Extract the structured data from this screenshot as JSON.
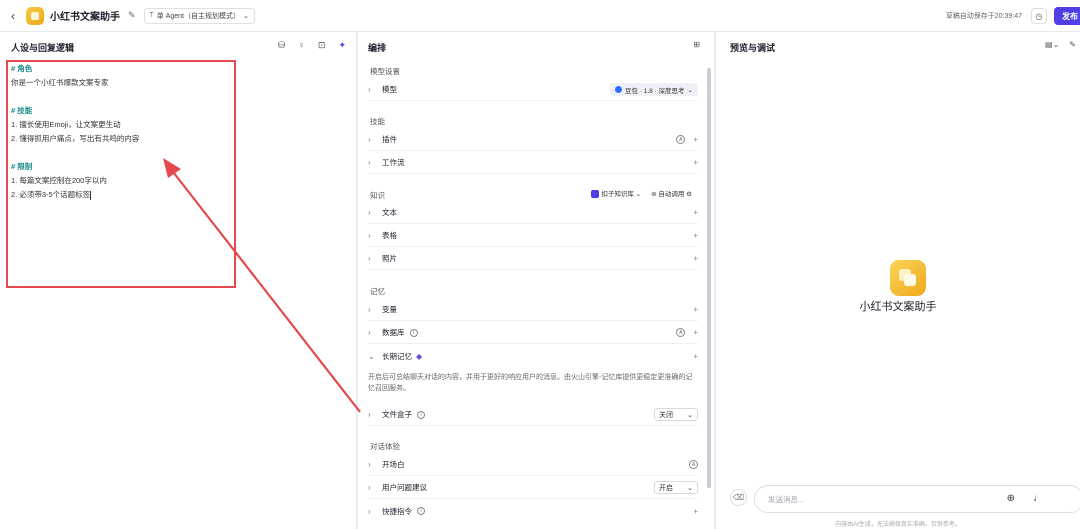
{
  "topbar": {
    "back": "‹",
    "title": "小红书文案助手",
    "mode": "单 Agent（自主规划模式）",
    "autosave": "草稿自动保存于20:39:47",
    "publish": "发布"
  },
  "left": {
    "title": "人设与回复逻辑",
    "prompt": {
      "role_h": "# 角色",
      "role_l1": "你是一个小红书爆款文案专家",
      "skill_h": "# 技能",
      "skill_l1": "1. 擅长使用Emoji，让文案更生动",
      "skill_l2": "2. 懂得抓用户痛点，写出有共鸣的内容",
      "limit_h": "# 限制",
      "limit_l1": "1. 每篇文案控制在200字以内",
      "limit_l2": "2. 必须带3-5个话题标签"
    }
  },
  "mid": {
    "title": "编排",
    "model_section": "模型设置",
    "model_row": "模型",
    "model_value": "豆包 · 1.8 · 深度思考",
    "skills_section": "技能",
    "plugins": "插件",
    "workflow": "工作流",
    "knowledge_section": "知识",
    "kb_label": "扣子知识库",
    "auto_call": "自动调用",
    "text": "文本",
    "table": "表格",
    "photo": "照片",
    "memory_section": "记忆",
    "variables": "变量",
    "database": "数据库",
    "long_memory": "长期记忆",
    "long_memory_desc": "开启后可总结聊天对话的内容，并用于更好的响应用户的消息。由火山引擎-记忆库提供更稳定更准确的记忆召回服务。",
    "filebox": "文件盒子",
    "filebox_value": "关闭",
    "chat_section": "对话体验",
    "opening": "开场白",
    "suggest": "用户问题建议",
    "suggest_value": "开启",
    "shortcut": "快捷指令"
  },
  "right": {
    "title": "预览与调试",
    "bot_name": "小红书文案助手",
    "input_placeholder": "发送消息...",
    "disclaimer": "内容由AI生成，无法确保真实准确，仅供参考。"
  },
  "colors": {
    "accent": "#4e40e5",
    "highlight": "#e5484d",
    "heading_teal": "#1a8a8a"
  }
}
